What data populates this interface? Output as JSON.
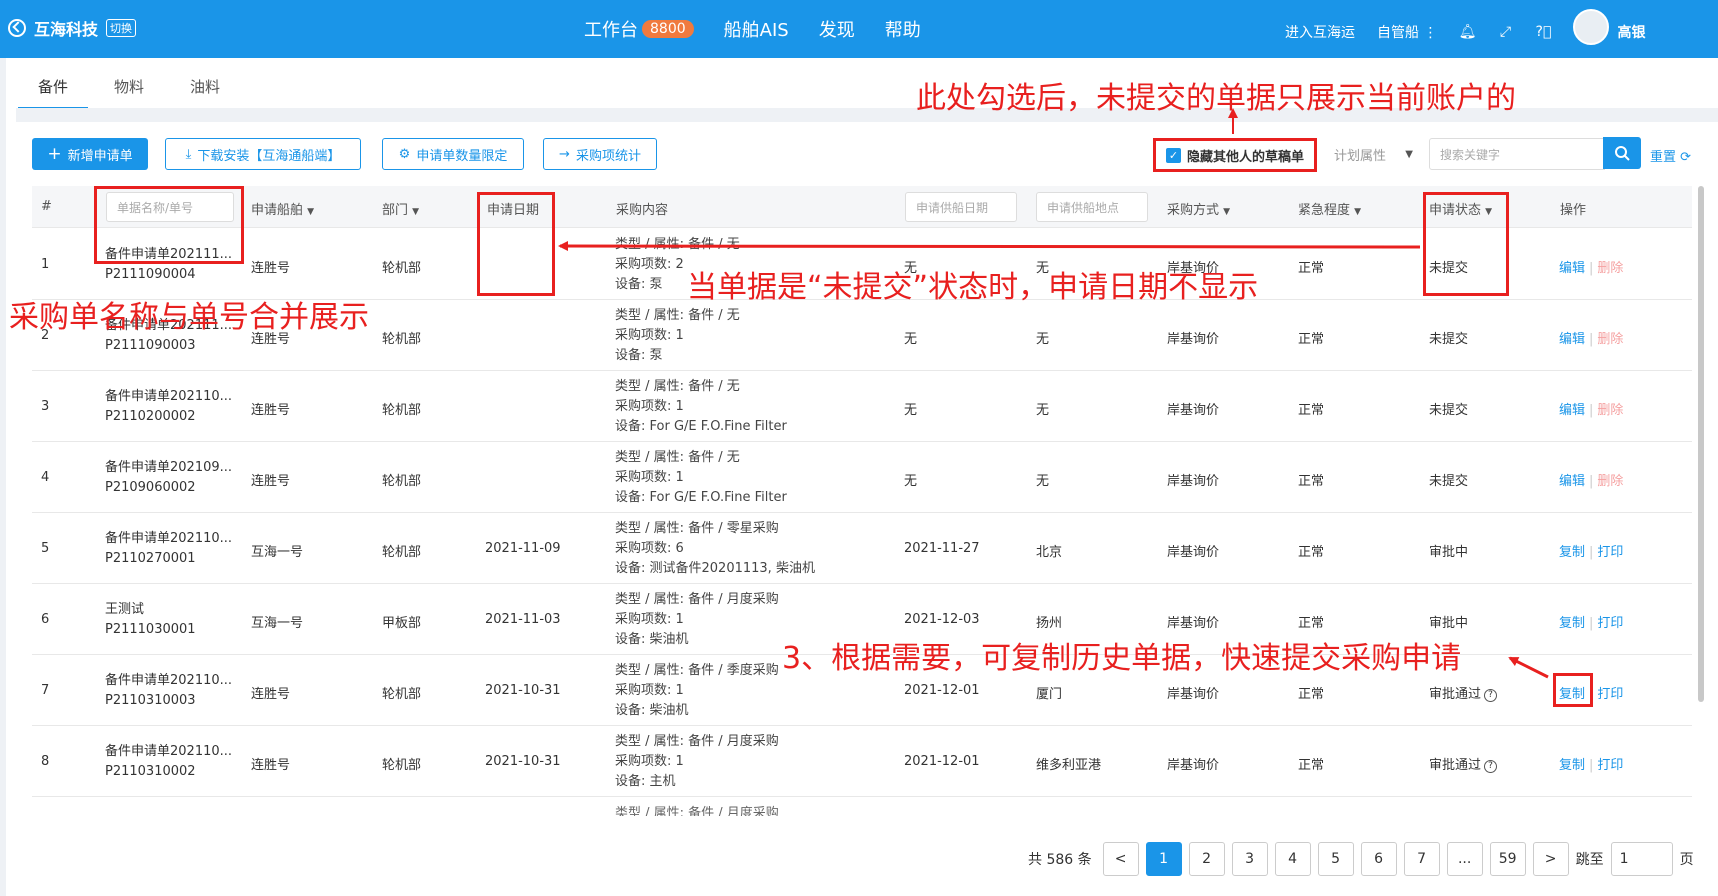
{
  "topbar": {
    "brand": "互海科技",
    "switch_label": "切换",
    "nav": [
      {
        "label": "工作台",
        "badge": "8800"
      },
      {
        "label": "船舶AIS"
      },
      {
        "label": "发现"
      },
      {
        "label": "帮助"
      }
    ],
    "enter_label": "进入互海运",
    "own_ship_label": "自管船",
    "user_name": "高银"
  },
  "tabs": [
    "备件",
    "物料",
    "油料"
  ],
  "toolbar": {
    "new_label": "新增申请单",
    "download_label": "下载安装【互海通船端】",
    "limit_label": "申请单数量限定",
    "stats_label": "采购项统计",
    "hide_drafts_label": "隐藏其他人的草稿单",
    "plan_attr_placeholder": "计划属性",
    "search_placeholder": "搜索关键字",
    "reset_label": "重置"
  },
  "table": {
    "headers": {
      "index": "#",
      "name_placeholder": "单据名称/单号",
      "ship": "申请船舶",
      "dept": "部门",
      "apply_date": "申请日期",
      "content": "采购内容",
      "supply_date_placeholder": "申请供船日期",
      "supply_place_placeholder": "申请供船地点",
      "method": "采购方式",
      "urgency": "紧急程度",
      "status": "申请状态",
      "ops": "操作"
    },
    "rows": [
      {
        "idx": "1",
        "name": "备件申请单202111...",
        "no": "P2111090004",
        "ship": "连胜号",
        "dept": "轮机部",
        "date": "",
        "type": "类型 / 属性:  备件 / 无",
        "count": "采购项数:  2",
        "equip": "设备:  泵",
        "supply_date": "无",
        "place": "无",
        "method": "岸基询价",
        "urgency": "正常",
        "status": "未提交",
        "op1": "编辑",
        "op2": "删除"
      },
      {
        "idx": "2",
        "name": "备件申请单202111...",
        "no": "P2111090003",
        "ship": "连胜号",
        "dept": "轮机部",
        "date": "",
        "type": "类型 / 属性:  备件 / 无",
        "count": "采购项数:  1",
        "equip": "设备:  泵",
        "supply_date": "无",
        "place": "无",
        "method": "岸基询价",
        "urgency": "正常",
        "status": "未提交",
        "op1": "编辑",
        "op2": "删除"
      },
      {
        "idx": "3",
        "name": "备件申请单202110...",
        "no": "P2110200002",
        "ship": "连胜号",
        "dept": "轮机部",
        "date": "",
        "type": "类型 / 属性:  备件 / 无",
        "count": "采购项数:  1",
        "equip": "设备:  For G/E F.O.Fine Filter",
        "supply_date": "无",
        "place": "无",
        "method": "岸基询价",
        "urgency": "正常",
        "status": "未提交",
        "op1": "编辑",
        "op2": "删除"
      },
      {
        "idx": "4",
        "name": "备件申请单202109...",
        "no": "P2109060002",
        "ship": "连胜号",
        "dept": "轮机部",
        "date": "",
        "type": "类型 / 属性:  备件 / 无",
        "count": "采购项数:  1",
        "equip": "设备:  For G/E F.O.Fine Filter",
        "supply_date": "无",
        "place": "无",
        "method": "岸基询价",
        "urgency": "正常",
        "status": "未提交",
        "op1": "编辑",
        "op2": "删除"
      },
      {
        "idx": "5",
        "name": "备件申请单202110...",
        "no": "P2110270001",
        "ship": "互海一号",
        "dept": "轮机部",
        "date": "2021-11-09",
        "type": "类型 / 属性:  备件 / 零星采购",
        "count": "采购项数:  6",
        "equip": "设备:  测试备件20201113, 柴油机",
        "supply_date": "2021-11-27",
        "place": "北京",
        "method": "岸基询价",
        "urgency": "正常",
        "status": "审批中",
        "op1": "复制",
        "op2": "打印"
      },
      {
        "idx": "6",
        "name": "王测试",
        "no": "P2111030001",
        "ship": "互海一号",
        "dept": "甲板部",
        "date": "2021-11-03",
        "type": "类型 / 属性:  备件 / 月度采购",
        "count": "采购项数:  1",
        "equip": "设备:  柴油机",
        "supply_date": "2021-12-03",
        "place": "扬州",
        "method": "岸基询价",
        "urgency": "正常",
        "status": "审批中",
        "op1": "复制",
        "op2": "打印"
      },
      {
        "idx": "7",
        "name": "备件申请单202110...",
        "no": "P2110310003",
        "ship": "连胜号",
        "dept": "轮机部",
        "date": "2021-10-31",
        "type": "类型 / 属性:  备件 / 季度采购",
        "count": "采购项数:  1",
        "equip": "设备:  柴油机",
        "supply_date": "2021-12-01",
        "place": "厦门",
        "method": "岸基询价",
        "urgency": "正常",
        "status": "审批通过",
        "op1": "复制",
        "op2": "打印"
      },
      {
        "idx": "8",
        "name": "备件申请单202110...",
        "no": "P2110310002",
        "ship": "连胜号",
        "dept": "轮机部",
        "date": "2021-10-31",
        "type": "类型 / 属性:  备件 / 月度采购",
        "count": "采购项数:  1",
        "equip": "设备:  主机",
        "supply_date": "2021-12-01",
        "place": "维多利亚港",
        "method": "岸基询价",
        "urgency": "正常",
        "status": "审批通过",
        "op1": "复制",
        "op2": "打印"
      }
    ],
    "partial_row": "类型 / 属性:  备件 / 月度采购"
  },
  "pagination": {
    "total": "共 586 条",
    "prev": "<",
    "pages": [
      "1",
      "2",
      "3",
      "4",
      "5",
      "6",
      "7",
      "...",
      "59"
    ],
    "next": ">",
    "jump_label": "跳至",
    "jump_value": "1",
    "page_suffix": "页"
  },
  "annotations": {
    "top": "此处勾选后，未提交的单据只展示当前账户的",
    "left": "采购单名称与单号合并展示",
    "middle": "当单据是“未提交”状态时，申请日期不显示",
    "bottom": "3、根据需要，可复制历史单据，快速提交采购申请"
  },
  "colors": {
    "brand": "#1a95e8",
    "annotation": "#e8201f",
    "badge": "#f07a3e"
  }
}
